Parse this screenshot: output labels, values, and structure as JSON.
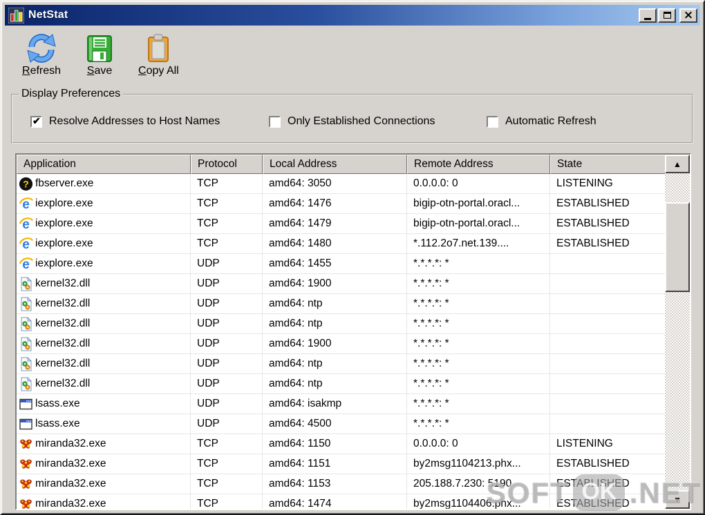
{
  "window": {
    "title": "NetStat",
    "controls": {
      "minimize": "minimize",
      "maximize": "maximize",
      "close": "close"
    }
  },
  "toolbar": {
    "buttons": [
      {
        "label": "Refresh",
        "icon": "refresh-icon"
      },
      {
        "label": "Save",
        "icon": "save-icon"
      },
      {
        "label": "Copy All",
        "icon": "copy-all-icon"
      }
    ]
  },
  "preferences": {
    "title": "Display Preferences",
    "options": [
      {
        "label": "Resolve Addresses to Host Names",
        "checked": true
      },
      {
        "label": "Only Established Connections",
        "checked": false
      },
      {
        "label": "Automatic Refresh",
        "checked": false
      }
    ]
  },
  "table": {
    "columns": [
      "Application",
      "Protocol",
      "Local Address",
      "Remote Address",
      "State"
    ],
    "rows": [
      {
        "app": "fbserver.exe",
        "icon": "firebird-icon",
        "protocol": "TCP",
        "local": "amd64: 3050",
        "remote": "0.0.0.0: 0",
        "state": "LISTENING"
      },
      {
        "app": "iexplore.exe",
        "icon": "ie-icon",
        "protocol": "TCP",
        "local": "amd64: 1476",
        "remote": "bigip-otn-portal.oracl...",
        "state": "ESTABLISHED"
      },
      {
        "app": "iexplore.exe",
        "icon": "ie-icon",
        "protocol": "TCP",
        "local": "amd64: 1479",
        "remote": "bigip-otn-portal.oracl...",
        "state": "ESTABLISHED"
      },
      {
        "app": "iexplore.exe",
        "icon": "ie-icon",
        "protocol": "TCP",
        "local": "amd64: 1480",
        "remote": "*.112.2o7.net.139....",
        "state": "ESTABLISHED"
      },
      {
        "app": "iexplore.exe",
        "icon": "ie-icon",
        "protocol": "UDP",
        "local": "amd64: 1455",
        "remote": "*.*.*.*: *",
        "state": ""
      },
      {
        "app": "kernel32.dll",
        "icon": "dll-icon",
        "protocol": "UDP",
        "local": "amd64: 1900",
        "remote": "*.*.*.*: *",
        "state": ""
      },
      {
        "app": "kernel32.dll",
        "icon": "dll-icon",
        "protocol": "UDP",
        "local": "amd64: ntp",
        "remote": "*.*.*.*: *",
        "state": ""
      },
      {
        "app": "kernel32.dll",
        "icon": "dll-icon",
        "protocol": "UDP",
        "local": "amd64: ntp",
        "remote": "*.*.*.*: *",
        "state": ""
      },
      {
        "app": "kernel32.dll",
        "icon": "dll-icon",
        "protocol": "UDP",
        "local": "amd64: 1900",
        "remote": "*.*.*.*: *",
        "state": ""
      },
      {
        "app": "kernel32.dll",
        "icon": "dll-icon",
        "protocol": "UDP",
        "local": "amd64: ntp",
        "remote": "*.*.*.*: *",
        "state": ""
      },
      {
        "app": "kernel32.dll",
        "icon": "dll-icon",
        "protocol": "UDP",
        "local": "amd64: ntp",
        "remote": "*.*.*.*: *",
        "state": ""
      },
      {
        "app": "lsass.exe",
        "icon": "window-icon",
        "protocol": "UDP",
        "local": "amd64: isakmp",
        "remote": "*.*.*.*: *",
        "state": ""
      },
      {
        "app": "lsass.exe",
        "icon": "window-icon",
        "protocol": "UDP",
        "local": "amd64: 4500",
        "remote": "*.*.*.*: *",
        "state": ""
      },
      {
        "app": "miranda32.exe",
        "icon": "butterfly-icon",
        "protocol": "TCP",
        "local": "amd64: 1150",
        "remote": "0.0.0.0: 0",
        "state": "LISTENING"
      },
      {
        "app": "miranda32.exe",
        "icon": "butterfly-icon",
        "protocol": "TCP",
        "local": "amd64: 1151",
        "remote": "by2msg1104213.phx...",
        "state": "ESTABLISHED"
      },
      {
        "app": "miranda32.exe",
        "icon": "butterfly-icon",
        "protocol": "TCP",
        "local": "amd64: 1153",
        "remote": "205.188.7.230: 5190",
        "state": "ESTABLISHED"
      },
      {
        "app": "miranda32.exe",
        "icon": "butterfly-icon",
        "protocol": "TCP",
        "local": "amd64: 1474",
        "remote": "by2msg1104406.phx...",
        "state": "ESTABLISHED"
      }
    ]
  },
  "watermark": {
    "part1": "SOFT",
    "part2": "OK",
    "part3": ".NET"
  },
  "colors": {
    "titlebar_start": "#0a246a",
    "titlebar_end": "#a6caf0",
    "window_bg": "#d6d3ce",
    "row_bg": "#ffffff"
  }
}
